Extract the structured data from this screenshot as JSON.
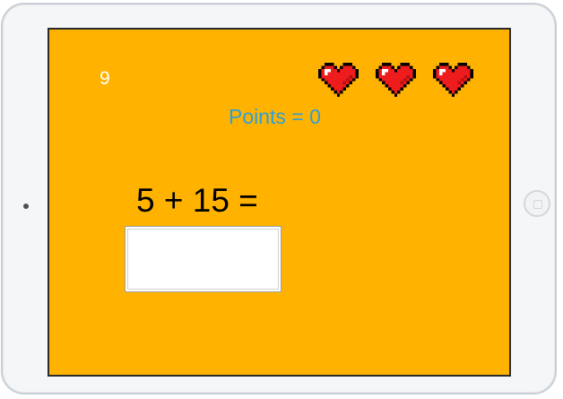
{
  "game": {
    "timer": "9",
    "points_text": "Points = 0",
    "lives": 3,
    "question": "5 + 15 =",
    "answer_value": ""
  },
  "colors": {
    "background": "#ffb300",
    "points_text": "#2e9fd8",
    "heart": "#ee1c1c",
    "timer_text": "#ffffff"
  },
  "icons": {
    "life": "heart-icon"
  }
}
